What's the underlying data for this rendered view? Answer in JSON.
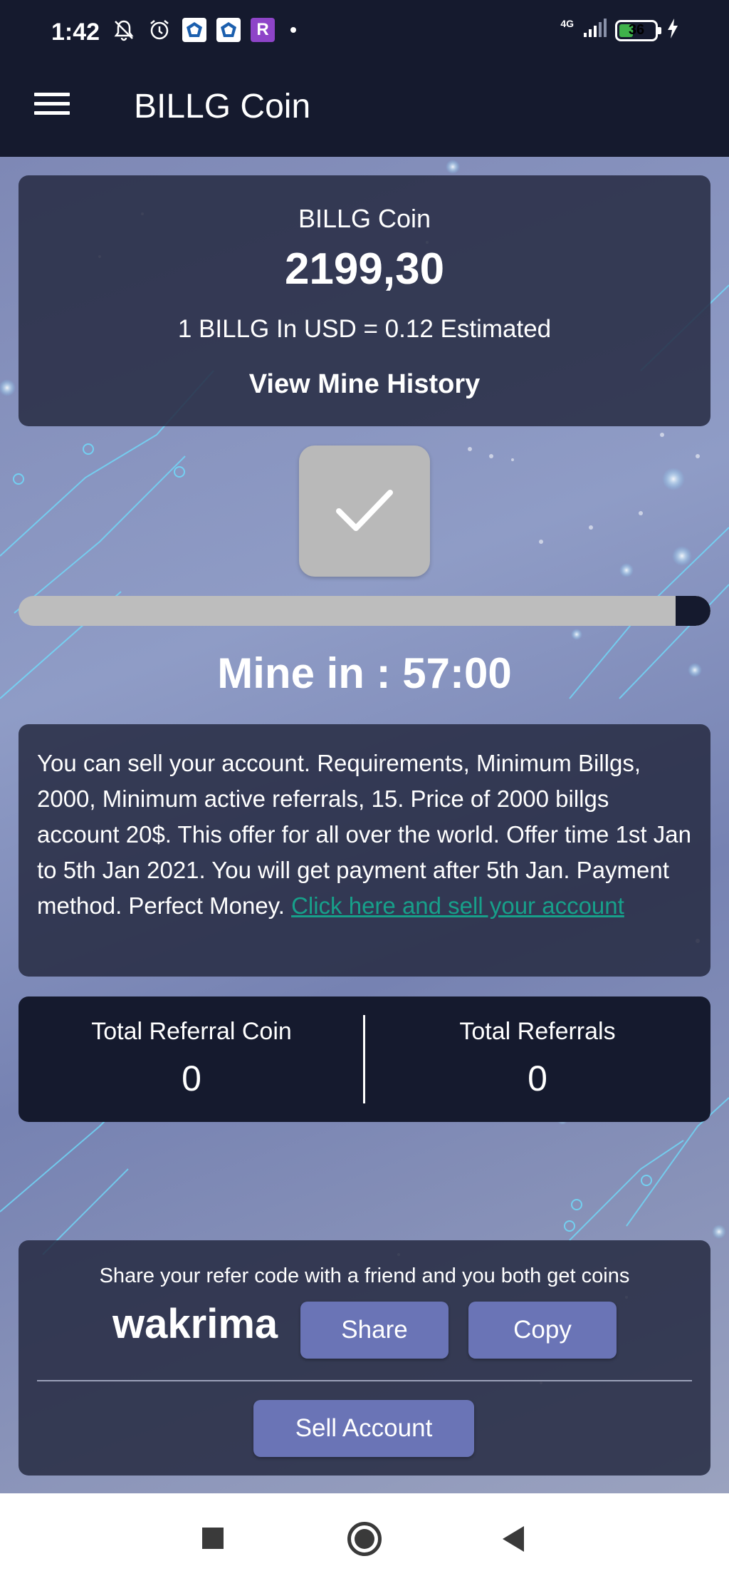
{
  "status_bar": {
    "time": "1:42",
    "network_label": "4G",
    "battery_level": "36",
    "battery_fraction": 0.36,
    "icons": [
      "mute-bell-icon",
      "alarm-icon",
      "app-icon",
      "app-icon",
      "r-app-icon",
      "dot-icon",
      "signal-icon",
      "battery-icon",
      "charging-bolt-icon"
    ],
    "r_app_letter": "R"
  },
  "app_bar": {
    "title": "BILLG Coin",
    "menu_icon": "hamburger-menu-icon"
  },
  "balance": {
    "coin_name": "BILLG Coin",
    "amount": "2199,30",
    "usd_rate": "1 BILLG In USD = 0.12 Estimated",
    "history_link": "View Mine History"
  },
  "mine": {
    "check_icon": "checkmark-icon",
    "progress_fraction": 0.05,
    "timer": "Mine in : 57:00"
  },
  "offer": {
    "text": "You can sell your account. Requirements, Minimum Billgs, 2000, Minimum active referrals, 15. Price of 2000 billgs account 20$. This offer for all over the world. Offer time 1st Jan to 5th Jan 2021. You will get payment after 5th Jan. Payment method. Perfect Money.",
    "link": "Click here and sell your account"
  },
  "referrals": {
    "coin_label": "Total Referral Coin",
    "coin_value": "0",
    "count_label": "Total Referrals",
    "count_value": "0"
  },
  "share": {
    "message": "Share your refer code with a friend and you both get coins",
    "code": "wakrima",
    "share_label": "Share",
    "copy_label": "Copy",
    "sell_label": "Sell Account"
  },
  "colors": {
    "app_bar": "#151a2e",
    "card": "#262b42",
    "button": "#6a74b6",
    "link": "#17a08a",
    "battery": "#3fb24a"
  },
  "nav_bar": {
    "icons": [
      "recents-square-icon",
      "home-circle-icon",
      "back-triangle-icon"
    ]
  }
}
